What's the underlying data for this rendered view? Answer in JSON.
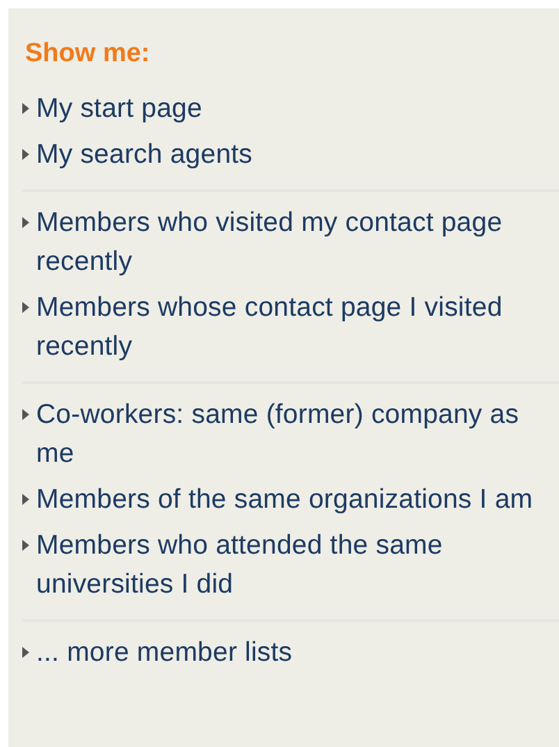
{
  "heading": "Show me:",
  "groups": [
    {
      "items": [
        "My start page",
        "My search agents"
      ]
    },
    {
      "items": [
        "Members who visited my contact page recently",
        "Members whose contact page I visited recently"
      ]
    },
    {
      "items": [
        "Co-workers: same (former) company as me",
        "Members of the same organizations I am",
        "Members who attended the same universities I did"
      ]
    },
    {
      "items": [
        "... more member lists"
      ]
    }
  ]
}
